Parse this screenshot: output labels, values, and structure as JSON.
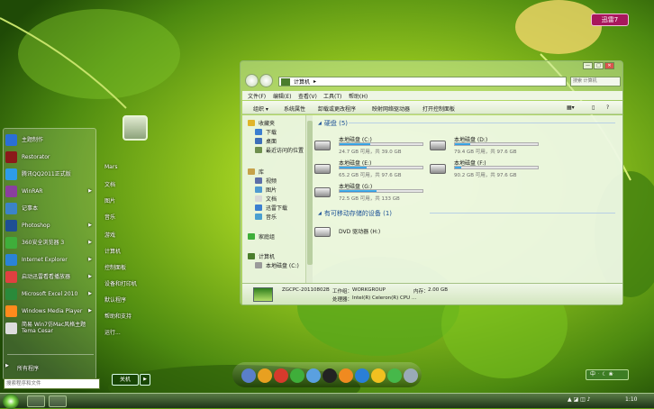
{
  "desktop": {
    "badge": "迅雷7"
  },
  "start_menu": {
    "pinned": [
      {
        "label": "主题制作",
        "color": "#2a6fd6",
        "arrow": false
      },
      {
        "label": "Restorator",
        "color": "#8b1a1a",
        "arrow": false
      },
      {
        "label": "腾讯QQ2011正式版",
        "color": "#2d9ce8",
        "arrow": false
      },
      {
        "label": "WinRAR",
        "color": "#8a3f9e",
        "arrow": true
      },
      {
        "label": "记事本",
        "color": "#3b83c9",
        "arrow": false
      },
      {
        "label": "Photoshop",
        "color": "#1e4f94",
        "arrow": true
      },
      {
        "label": "360安全浏览器 3",
        "color": "#3fae3a",
        "arrow": true
      },
      {
        "label": "Internet Explorer",
        "color": "#2a83d6",
        "arrow": true
      },
      {
        "label": "启动迅雷看看播放器",
        "color": "#e04040",
        "arrow": true
      },
      {
        "label": "Microsoft Excel 2010",
        "color": "#2a8a3a",
        "arrow": true
      },
      {
        "label": "Windows Media Player",
        "color": "#ff8a1c",
        "arrow": true
      },
      {
        "label": "简易 Win7仿Mac风格主题 Tema Cesar",
        "color": "#dddddd",
        "arrow": false
      }
    ],
    "all_programs": "所有程序",
    "search_placeholder": "搜索程序和文件",
    "right_items": [
      "Mars",
      "文档",
      "图片",
      "音乐",
      "游戏",
      "计算机",
      "控制面板",
      "设备和打印机",
      "默认程序",
      "帮助和支持",
      "运行..."
    ],
    "shutdown": "关机",
    "shutdown_arrow": "▶"
  },
  "explorer": {
    "window_buttons": [
      "—",
      "□",
      "✕"
    ],
    "address": [
      "计算机",
      "▸"
    ],
    "search_placeholder": "搜索 计算机",
    "menu": [
      "文件(F)",
      "编辑(E)",
      "查看(V)",
      "工具(T)",
      "帮助(H)"
    ],
    "toolbar": [
      "组织 ▾",
      "系统属性",
      "卸载或更改程序",
      "映射网络驱动器",
      "打开控制面板"
    ],
    "nav": [
      {
        "label": "收藏夹",
        "color": "#e0b52a"
      },
      {
        "label": "下载",
        "color": "#3b7fd0"
      },
      {
        "label": "桌面",
        "color": "#3d6fb8"
      },
      {
        "label": "最近访问的位置",
        "color": "#6e8f4e"
      },
      {
        "label": "库",
        "color": "#c6a24a"
      },
      {
        "label": "视频",
        "color": "#5c6fa8"
      },
      {
        "label": "图片",
        "color": "#4f9bd0"
      },
      {
        "label": "文档",
        "color": "#d8d8d8"
      },
      {
        "label": "迅雷下载",
        "color": "#3b7fd0"
      },
      {
        "label": "音乐",
        "color": "#4aa0d0"
      },
      {
        "label": "家庭组",
        "color": "#3fae3a"
      },
      {
        "label": "计算机",
        "color": "#4a7d2c"
      },
      {
        "label": "本地磁盘 (C:)",
        "color": "#9a9a9a"
      }
    ],
    "hdd_header": "硬盘 (5)",
    "drives": [
      {
        "name": "本地磁盘 (C:)",
        "free": "24.7 GB 可用，共 39.0 GB",
        "used": 0.37
      },
      {
        "name": "本地磁盘 (D:)",
        "free": "79.4 GB 可用，共 97.6 GB",
        "used": 0.19
      },
      {
        "name": "本地磁盘 (E:)",
        "free": "65.2 GB 可用，共 97.6 GB",
        "used": 0.33
      },
      {
        "name": "本地磁盘 (F:)",
        "free": "90.2 GB 可用，共 97.6 GB",
        "used": 0.08
      },
      {
        "name": "本地磁盘 (G:)",
        "free": "72.5 GB 可用，共 133 GB",
        "used": 0.45
      }
    ],
    "removable_header": "有可移动存储的设备 (1)",
    "dvd": "DVD 驱动器 (H:)",
    "details": {
      "computer": "ZGCPC-20110802B",
      "workgroup_label": "工作组：",
      "workgroup": "WORKGROUP",
      "memory_label": "内存：",
      "memory": "2.00 GB",
      "processor_label": "处理器：",
      "processor": "Intel(R) Celeron(R) CPU ..."
    }
  },
  "taskbar": {
    "clock": "1:10",
    "ime": "中 ᛫ ☾ ❀"
  }
}
